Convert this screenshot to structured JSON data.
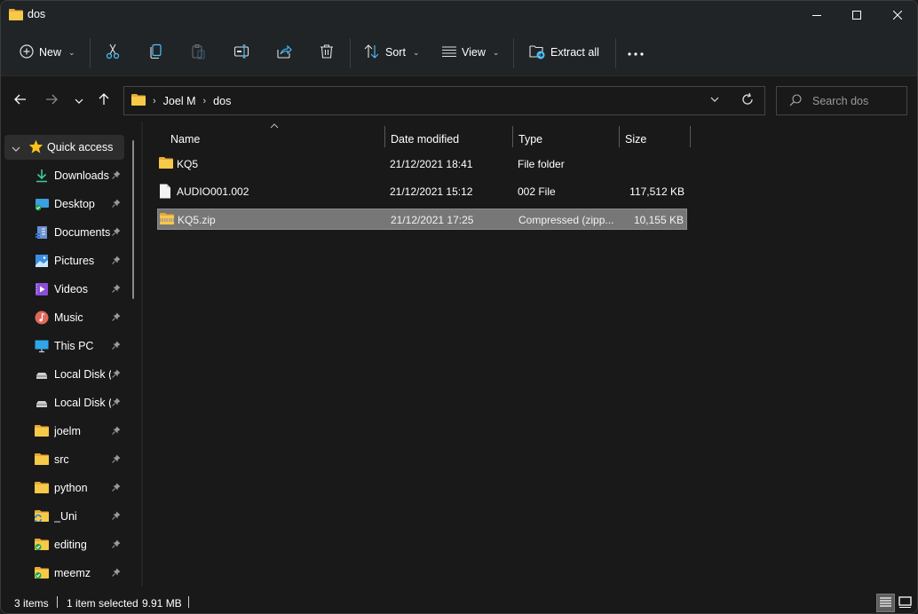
{
  "window": {
    "title": "dos",
    "controls": [
      "minimize",
      "maximize",
      "close"
    ]
  },
  "toolbar": {
    "new_label": "New",
    "cut": "cut-icon",
    "copy": "copy-icon",
    "paste": "paste-icon",
    "rename": "rename-icon",
    "share": "share-icon",
    "delete": "delete-icon",
    "sort_label": "Sort",
    "view_label": "View",
    "extract_label": "Extract all",
    "more": "more-icon"
  },
  "address": {
    "breadcrumbs": [
      "Joel M",
      "dos"
    ]
  },
  "search": {
    "placeholder": "Search dos"
  },
  "sidebar": {
    "quick_access": "Quick access",
    "items": [
      {
        "label": "Downloads",
        "icon": "downloads-icon"
      },
      {
        "label": "Desktop",
        "icon": "desktop-icon"
      },
      {
        "label": "Documents",
        "icon": "documents-icon"
      },
      {
        "label": "Pictures",
        "icon": "pictures-icon"
      },
      {
        "label": "Videos",
        "icon": "videos-icon"
      },
      {
        "label": "Music",
        "icon": "music-icon"
      },
      {
        "label": "This PC",
        "icon": "pc-icon"
      },
      {
        "label": "Local Disk (C:)",
        "icon": "disk-icon"
      },
      {
        "label": "Local Disk (D:)",
        "icon": "disk-icon"
      },
      {
        "label": "joelm",
        "icon": "folder-icon"
      },
      {
        "label": "src",
        "icon": "folder-icon"
      },
      {
        "label": "python",
        "icon": "folder-icon"
      },
      {
        "label": "_Uni",
        "icon": "folder-sync-icon"
      },
      {
        "label": "editing",
        "icon": "folder-synced-icon"
      },
      {
        "label": "meemz",
        "icon": "folder-synced-icon"
      }
    ]
  },
  "columns": {
    "name": "Name",
    "date": "Date modified",
    "type": "Type",
    "size": "Size"
  },
  "files": [
    {
      "name": "KQ5",
      "date": "21/12/2021 18:41",
      "type": "File folder",
      "size": "",
      "icon": "folder-icon",
      "selected": false
    },
    {
      "name": "AUDIO001.002",
      "date": "21/12/2021 15:12",
      "type": "002 File",
      "size": "117,512 KB",
      "icon": "file-icon",
      "selected": false
    },
    {
      "name": "KQ5.zip",
      "date": "21/12/2021 17:25",
      "type": "Compressed (zipp...",
      "size": "10,155 KB",
      "icon": "zip-folder-icon",
      "selected": true
    }
  ],
  "status": {
    "item_count": "3 items",
    "selection": "1 item selected",
    "selection_size": "9.91 MB"
  },
  "colors": {
    "folder": "#f4c542",
    "accent_blue": "#4cc2ff",
    "selected_row": "#777777"
  }
}
